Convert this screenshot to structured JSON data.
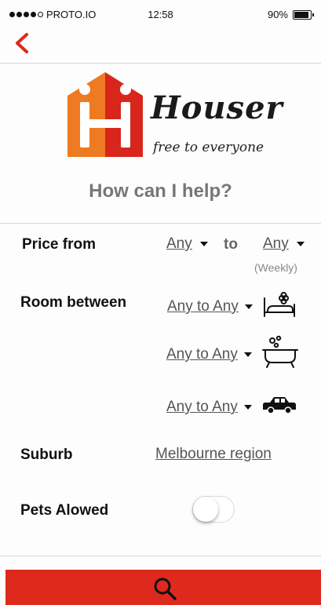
{
  "status_bar": {
    "carrier": "PROTO.IO",
    "time": "12:58",
    "battery_percent": "90%"
  },
  "nav": {
    "back_icon": "chevron-left-icon"
  },
  "brand": {
    "name": "Houser",
    "tagline": "free to everyone",
    "logo_colors": [
      "#ee7a22",
      "#d9261c"
    ]
  },
  "heading": "How can I help?",
  "price": {
    "label": "Price  from",
    "from_value": "Any",
    "to_word": "to",
    "to_value": "Any",
    "period_note": "(Weekly)"
  },
  "rooms": {
    "label": "Room  between",
    "items": [
      {
        "value": "Any to Any",
        "icon": "bed-icon"
      },
      {
        "value": "Any to Any",
        "icon": "bathtub-icon"
      },
      {
        "value": "Any to Any",
        "icon": "car-icon"
      }
    ]
  },
  "suburb": {
    "label": "Suburb",
    "value": "Melbourne region"
  },
  "pets": {
    "label": "Pets Alowed",
    "enabled": false
  },
  "search_button": {
    "icon": "search-icon",
    "color": "#dd2a1d"
  },
  "accent_color": "#dd2a1d"
}
